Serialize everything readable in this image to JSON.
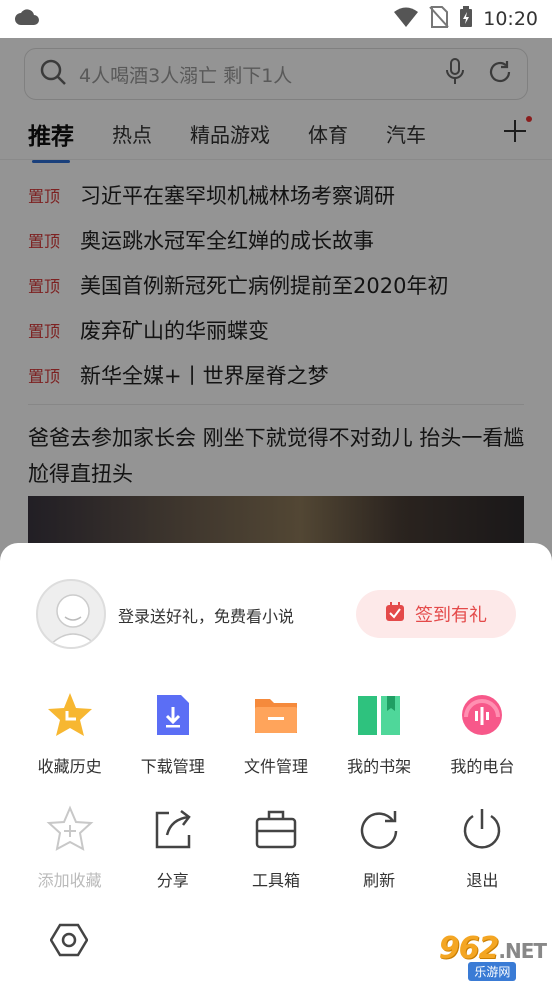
{
  "status_bar": {
    "time": "10:20"
  },
  "search": {
    "placeholder": "4人喝酒3人溺亡 剩下1人"
  },
  "tabs": [
    {
      "label": "推荐",
      "active": true
    },
    {
      "label": "热点"
    },
    {
      "label": "精品游戏"
    },
    {
      "label": "体育"
    },
    {
      "label": "汽车"
    }
  ],
  "news": {
    "pinned_tag": "置顶",
    "pinned": [
      "习近平在塞罕坝机械林场考察调研",
      "奥运跳水冠军全红婵的成长故事",
      "美国首例新冠死亡病例提前至2020年初",
      "废弃矿山的华丽蝶变",
      "新华全媒+丨世界屋脊之梦"
    ],
    "article_title": "爸爸去参加家长会 刚坐下就觉得不对劲儿 抬头一看尴尬得直扭头"
  },
  "sheet": {
    "login_text": "登录送好礼，免费看小说",
    "sign_button": "签到有礼",
    "row1": [
      {
        "label": "收藏历史",
        "icon": "star-history-icon"
      },
      {
        "label": "下载管理",
        "icon": "download-icon"
      },
      {
        "label": "文件管理",
        "icon": "folder-icon"
      },
      {
        "label": "我的书架",
        "icon": "book-icon"
      },
      {
        "label": "我的电台",
        "icon": "radio-icon"
      }
    ],
    "row2": [
      {
        "label": "添加收藏",
        "icon": "add-favorite-icon",
        "disabled": true
      },
      {
        "label": "分享",
        "icon": "share-icon"
      },
      {
        "label": "工具箱",
        "icon": "toolbox-icon"
      },
      {
        "label": "刷新",
        "icon": "refresh-icon"
      },
      {
        "label": "退出",
        "icon": "power-icon"
      }
    ]
  },
  "watermark": {
    "number": "962",
    "suffix": ".NET",
    "sub": "乐游网"
  },
  "colors": {
    "accent": "#2d6fd6",
    "pinned_red": "#d83a3a",
    "sign_red": "#e44a4a"
  }
}
